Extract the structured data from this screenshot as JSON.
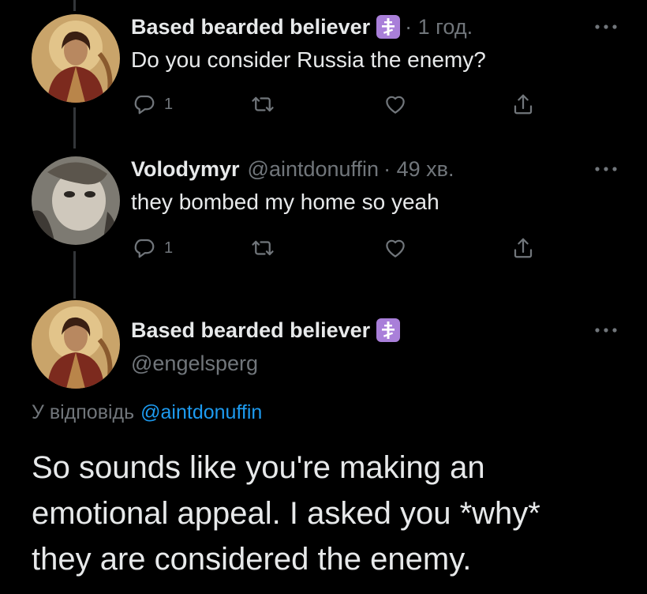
{
  "tweets": [
    {
      "name": "Based bearded believer",
      "handle": "",
      "time": "· 1 год.",
      "text": "Do you consider Russia the enemy?",
      "replies": "1"
    },
    {
      "name": "Volodymyr",
      "handle": "@aintdonuffin",
      "time": "· 49 хв.",
      "text": "they bombed my home so yeah",
      "replies": "1"
    }
  ],
  "main_tweet": {
    "name": "Based bearded believer",
    "handle": "@engelsperg",
    "reply_prefix": "У відповідь",
    "reply_mention": "@aintdonuffin",
    "text_lines": [
      "So sounds like you're making an",
      "emotional appeal. I asked you *why*",
      "they are considered the enemy."
    ]
  },
  "icons": {
    "badge": "orthodox-cross-icon",
    "reply": "reply-icon",
    "retweet": "retweet-icon",
    "like": "heart-icon",
    "share": "share-icon",
    "more": "more-icon"
  },
  "colors": {
    "background": "#000000",
    "text": "#e7e9ea",
    "muted": "#71767b",
    "link": "#1d9bf0",
    "badge": "#a97fd9",
    "thread_line": "#333639"
  }
}
